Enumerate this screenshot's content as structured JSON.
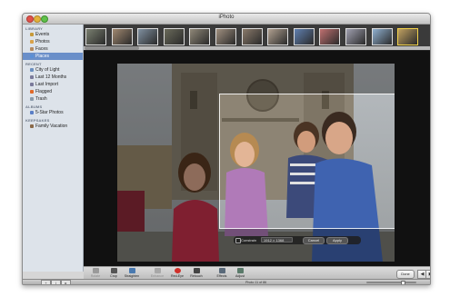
{
  "window": {
    "title": "iPhoto"
  },
  "sidebar": {
    "sections": [
      {
        "header": "LIBRARY",
        "items": [
          {
            "label": "Events",
            "icon": "events-icon",
            "color": "#c79a3a"
          },
          {
            "label": "Photos",
            "icon": "photos-icon",
            "color": "#d9a24a"
          },
          {
            "label": "Faces",
            "icon": "faces-icon",
            "color": "#b58a5f"
          },
          {
            "label": "Places",
            "icon": "places-icon",
            "color": "#5a8fd6",
            "selected": true
          }
        ]
      },
      {
        "header": "RECENT",
        "items": [
          {
            "label": "City of Light",
            "icon": "event-icon",
            "color": "#6b8fbf"
          },
          {
            "label": "Last 12 Months",
            "icon": "calendar-icon",
            "color": "#7a7a9a"
          },
          {
            "label": "Last Import",
            "icon": "import-icon",
            "color": "#7a7a9a"
          },
          {
            "label": "Flagged",
            "icon": "flag-icon",
            "color": "#e06a2a"
          },
          {
            "label": "Trash",
            "icon": "trash-icon",
            "color": "#8a9aaa"
          }
        ]
      },
      {
        "header": "ALBUMS",
        "items": [
          {
            "label": "5-Star Photos",
            "icon": "smart-album-icon",
            "color": "#5a7fc6"
          }
        ]
      },
      {
        "header": "KEEPSAKES",
        "items": [
          {
            "label": "Family Vacation",
            "icon": "book-icon",
            "color": "#8a6a4a"
          }
        ]
      }
    ]
  },
  "filmstrip": {
    "selected_index": 12,
    "thumbs": [
      "#7a8070",
      "#a08870",
      "#8090a0",
      "#6a6a5a",
      "#908878",
      "#a09080",
      "#8a7a6a",
      "#b0a090",
      "#6080b0",
      "#c07070",
      "#a0a0b0",
      "#90b0d0",
      "#c0a060"
    ]
  },
  "crop": {
    "constrain_label": "Constrain",
    "size_value": "1912 × 1368",
    "cancel_label": "Cancel",
    "apply_label": "Apply"
  },
  "toolbar": {
    "tools": [
      {
        "label": "Rotate",
        "icon": "rotate-icon",
        "color": "#9a9a9a",
        "disabled": true
      },
      {
        "label": "Crop",
        "icon": "crop-icon",
        "color": "#555555",
        "disabled": false
      },
      {
        "label": "Straighten",
        "icon": "straighten-icon",
        "color": "#4a7ab0",
        "disabled": false
      },
      {
        "label": "Enhance",
        "icon": "enhance-icon",
        "color": "#a8a8a8",
        "disabled": true
      },
      {
        "label": "Red-Eye",
        "icon": "red-eye-icon",
        "color": "#d0302a",
        "disabled": false
      },
      {
        "label": "Retouch",
        "icon": "retouch-icon",
        "color": "#444444",
        "disabled": false
      },
      {
        "label": "Effects",
        "icon": "effects-icon",
        "color": "#5a6a7a",
        "disabled": false
      },
      {
        "label": "Adjust",
        "icon": "adjust-icon",
        "color": "#5a7a6a",
        "disabled": false
      }
    ],
    "done_label": "Done",
    "prev_icon": "◀",
    "next_icon": "▶"
  },
  "bottom_bar": {
    "add_icon": "+",
    "info_icon": "i",
    "slideshow_icon": "▸",
    "status": "Photo 11 of 86",
    "zoom": 0.75
  }
}
